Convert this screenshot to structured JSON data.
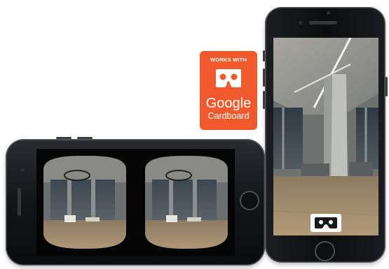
{
  "badge": {
    "top_text": "WORKS WITH",
    "line1": "Google",
    "line2": "Cardboard"
  },
  "colors": {
    "badge_orange": "#f0592b",
    "phone_body": "#141517",
    "floor_wood": "#a08a6c",
    "night_city": "#34424e"
  },
  "icons": [
    "cardboard-logo-icon",
    "cardboard-viewer-icon"
  ]
}
